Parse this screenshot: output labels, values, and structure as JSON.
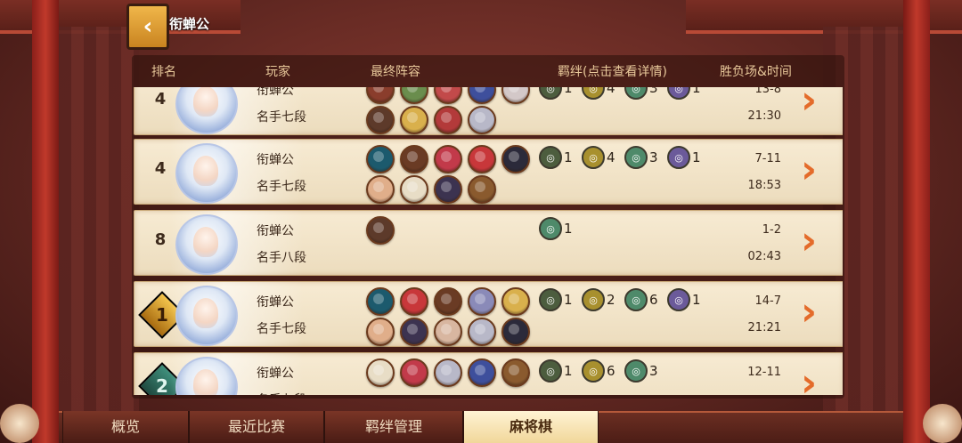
{
  "window": {
    "player_title": "衔蝉公"
  },
  "header": {
    "rank": "排名",
    "player": "玩家",
    "lineup": "最终阵容",
    "bonds": "羁绊(点击查看详情)",
    "result": "胜负场&时间"
  },
  "rows": [
    {
      "rank": "4",
      "rank_style": "plain",
      "name": "衔蝉公",
      "level": "名手七段",
      "score": "13-8",
      "time": "21:30",
      "lineup": [
        [
          "#8a3d2c",
          "#6a8d4d",
          "#c24a4a",
          "#3e4f9c",
          "#d3c8c8"
        ],
        [
          "#5d3a2a",
          "#d9b04c",
          "#b33a3a",
          "#b8b8c8"
        ]
      ],
      "bonds": [
        {
          "color": "#4c5d3e",
          "value": "1"
        },
        {
          "color": "#a8902e",
          "value": "4"
        },
        {
          "color": "#4e8a6a",
          "value": "3"
        },
        {
          "color": "#6b5a9a",
          "value": "1"
        }
      ]
    },
    {
      "rank": "4",
      "rank_style": "plain",
      "name": "衔蝉公",
      "level": "名手七段",
      "score": "7-11",
      "time": "18:53",
      "lineup": [
        [
          "#1c5a6d",
          "#6a3b24",
          "#c23a4a",
          "#c8373a",
          "#2b2a3a"
        ],
        [
          "#e0ae8a",
          "#e8ddc6",
          "#3c3350",
          "#8a5a2e"
        ]
      ],
      "bonds": [
        {
          "color": "#4c5d3e",
          "value": "1"
        },
        {
          "color": "#a8902e",
          "value": "4"
        },
        {
          "color": "#4e8a6a",
          "value": "3"
        },
        {
          "color": "#6b5a9a",
          "value": "1"
        }
      ]
    },
    {
      "rank": "8",
      "rank_style": "plain",
      "name": "衔蝉公",
      "level": "名手八段",
      "score": "1-2",
      "time": "02:43",
      "lineup": [
        [
          "#5d3a2a"
        ]
      ],
      "bonds": [
        {
          "color": "#4e8a6a",
          "value": "1"
        }
      ]
    },
    {
      "rank": "1",
      "rank_style": "gold",
      "name": "衔蝉公",
      "level": "名手七段",
      "score": "14-7",
      "time": "21:21",
      "lineup": [
        [
          "#1c5a6d",
          "#c8373a",
          "#6a3b24",
          "#8a8ab8",
          "#d9b04c"
        ],
        [
          "#e0ae8a",
          "#3c3350",
          "#d8b6a0",
          "#b8b8c8",
          "#2b2a3a"
        ]
      ],
      "bonds": [
        {
          "color": "#4c5d3e",
          "value": "1"
        },
        {
          "color": "#a8902e",
          "value": "2"
        },
        {
          "color": "#4e8a6a",
          "value": "6"
        },
        {
          "color": "#6b5a9a",
          "value": "1"
        }
      ]
    },
    {
      "rank": "2",
      "rank_style": "teal",
      "name": "衔蝉公",
      "level": "名手七段",
      "score": "12-11",
      "time": "",
      "lineup": [
        [
          "#e8ddc6",
          "#c23a4a",
          "#b8b8c8",
          "#3e4f9c",
          "#8a5a2e"
        ]
      ],
      "bonds": [
        {
          "color": "#4c5d3e",
          "value": "1"
        },
        {
          "color": "#a8902e",
          "value": "6"
        },
        {
          "color": "#4e8a6a",
          "value": "3"
        }
      ]
    }
  ],
  "tabs": [
    {
      "label": "概览"
    },
    {
      "label": "最近比赛"
    },
    {
      "label": "羁绊管理"
    },
    {
      "label": "麻将棋"
    }
  ]
}
